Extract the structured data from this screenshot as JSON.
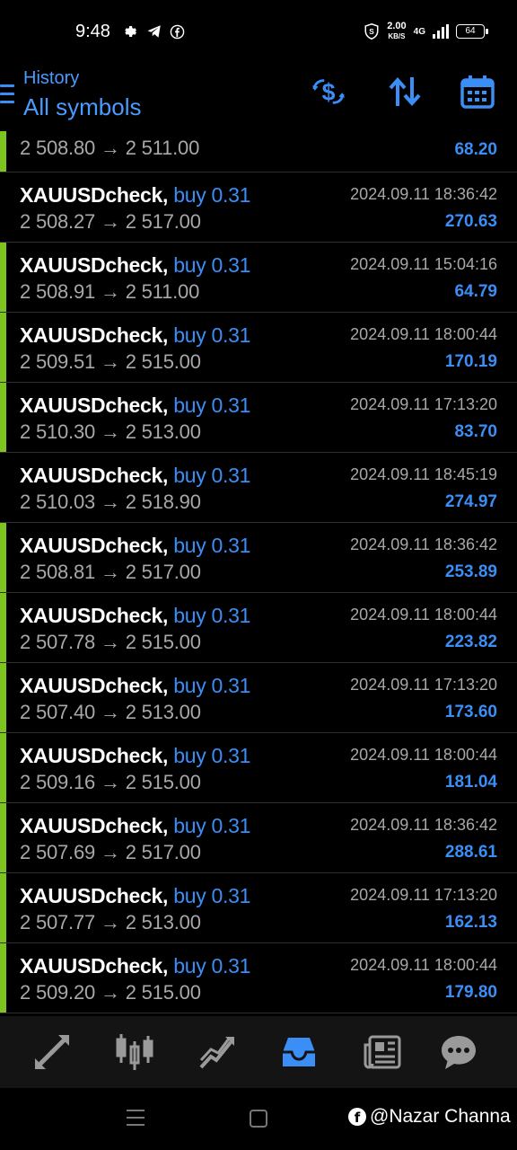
{
  "status_bar": {
    "time": "9:48",
    "left_icons": [
      "gear-icon",
      "telegram-icon",
      "facebook-icon"
    ],
    "net_speed_value": "2.00",
    "net_speed_unit": "KB/S",
    "network": "4G",
    "battery": "64"
  },
  "header": {
    "subtitle": "History",
    "title": "All symbols",
    "buttons": [
      "currency-exchange-icon",
      "sort-icon",
      "calendar-icon"
    ]
  },
  "colors": {
    "accent": "#3b8ef5",
    "profit": "#3b8ef5",
    "row_indicator": "#7cc521",
    "background": "#000000"
  },
  "trades": [
    {
      "symbol": "",
      "type": "",
      "open": "2 508.80",
      "close": "2 511.00",
      "time": "",
      "profit": "68.20",
      "indicator": true,
      "partial": true
    },
    {
      "symbol": "XAUUSDcheck,",
      "type": "buy 0.31",
      "open": "2 508.27",
      "close": "2 517.00",
      "time": "2024.09.11 18:36:42",
      "profit": "270.63",
      "indicator": false
    },
    {
      "symbol": "XAUUSDcheck,",
      "type": "buy 0.31",
      "open": "2 508.91",
      "close": "2 511.00",
      "time": "2024.09.11 15:04:16",
      "profit": "64.79",
      "indicator": true
    },
    {
      "symbol": "XAUUSDcheck,",
      "type": "buy 0.31",
      "open": "2 509.51",
      "close": "2 515.00",
      "time": "2024.09.11 18:00:44",
      "profit": "170.19",
      "indicator": true
    },
    {
      "symbol": "XAUUSDcheck,",
      "type": "buy 0.31",
      "open": "2 510.30",
      "close": "2 513.00",
      "time": "2024.09.11 17:13:20",
      "profit": "83.70",
      "indicator": true
    },
    {
      "symbol": "XAUUSDcheck,",
      "type": "buy 0.31",
      "open": "2 510.03",
      "close": "2 518.90",
      "time": "2024.09.11 18:45:19",
      "profit": "274.97",
      "indicator": false
    },
    {
      "symbol": "XAUUSDcheck,",
      "type": "buy 0.31",
      "open": "2 508.81",
      "close": "2 517.00",
      "time": "2024.09.11 18:36:42",
      "profit": "253.89",
      "indicator": true
    },
    {
      "symbol": "XAUUSDcheck,",
      "type": "buy 0.31",
      "open": "2 507.78",
      "close": "2 515.00",
      "time": "2024.09.11 18:00:44",
      "profit": "223.82",
      "indicator": true
    },
    {
      "symbol": "XAUUSDcheck,",
      "type": "buy 0.31",
      "open": "2 507.40",
      "close": "2 513.00",
      "time": "2024.09.11 17:13:20",
      "profit": "173.60",
      "indicator": true
    },
    {
      "symbol": "XAUUSDcheck,",
      "type": "buy 0.31",
      "open": "2 509.16",
      "close": "2 515.00",
      "time": "2024.09.11 18:00:44",
      "profit": "181.04",
      "indicator": true
    },
    {
      "symbol": "XAUUSDcheck,",
      "type": "buy 0.31",
      "open": "2 507.69",
      "close": "2 517.00",
      "time": "2024.09.11 18:36:42",
      "profit": "288.61",
      "indicator": true
    },
    {
      "symbol": "XAUUSDcheck,",
      "type": "buy 0.31",
      "open": "2 507.77",
      "close": "2 513.00",
      "time": "2024.09.11 17:13:20",
      "profit": "162.13",
      "indicator": true
    },
    {
      "symbol": "XAUUSDcheck,",
      "type": "buy 0.31",
      "open": "2 509.20",
      "close": "2 515.00",
      "time": "2024.09.11 18:00:44",
      "profit": "179.80",
      "indicator": true
    }
  ],
  "bottom_nav": {
    "items": [
      "quotes-icon",
      "chart-candles-icon",
      "trade-icon",
      "history-icon",
      "news-icon",
      "messages-icon"
    ],
    "active": "history-icon"
  },
  "watermark": "@Nazar Channa"
}
